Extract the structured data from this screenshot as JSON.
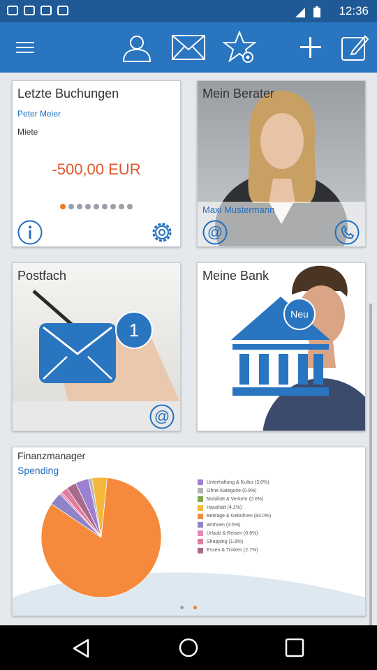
{
  "status": {
    "time": "12:36"
  },
  "toolbar": {
    "icons": [
      "menu-icon",
      "person-icon",
      "mail-icon",
      "star-settings-icon",
      "plus-icon",
      "edit-icon"
    ]
  },
  "cards": {
    "bookings": {
      "title": "Letzte Buchungen",
      "name": "Peter Meier",
      "subtitle": "Miete",
      "amount": "-500,00 EUR",
      "page_count": 9,
      "active_page": 0
    },
    "advisor": {
      "title": "Mein Berater",
      "name": "Maxi Mustermann"
    },
    "mailbox": {
      "title": "Postfach",
      "badge": "1"
    },
    "bank": {
      "title": "Meine Bank",
      "badge": "Neu"
    },
    "finance": {
      "title": "Finanzmanager",
      "subtitle": "Spending",
      "legend": [
        "Unterhaltung & Kultur (3.6%)",
        "Ohne Kategorie (0.9%)",
        "Mobilität & Verkehr (0.0%)",
        "Haushalt (4.1%)",
        "Beiträge & Gebühren (83.0%)",
        "Wohnen (3.5%)",
        "Urlaub & Reisen (0.6%)",
        "Shopping (1.8%)",
        "Essen & Trinken (2.7%)"
      ],
      "active_page": 1
    }
  },
  "chart_data": {
    "type": "pie",
    "title": "Spending",
    "categories": [
      "Unterhaltung & Kultur",
      "Ohne Kategorie",
      "Mobilität & Verkehr",
      "Haushalt",
      "Beiträge & Gebühren",
      "Wohnen",
      "Urlaub & Reisen",
      "Shopping",
      "Essen & Trinken"
    ],
    "values": [
      3.6,
      0.9,
      0.0,
      4.1,
      83.0,
      3.5,
      0.6,
      1.8,
      2.7
    ],
    "colors": [
      "#9b7fd0",
      "#b3b3b3",
      "#7fa84a",
      "#f5b83c",
      "#f58a3c",
      "#8f84c8",
      "#e986b7",
      "#e27c9c",
      "#a86a8a"
    ],
    "legend": "right"
  }
}
